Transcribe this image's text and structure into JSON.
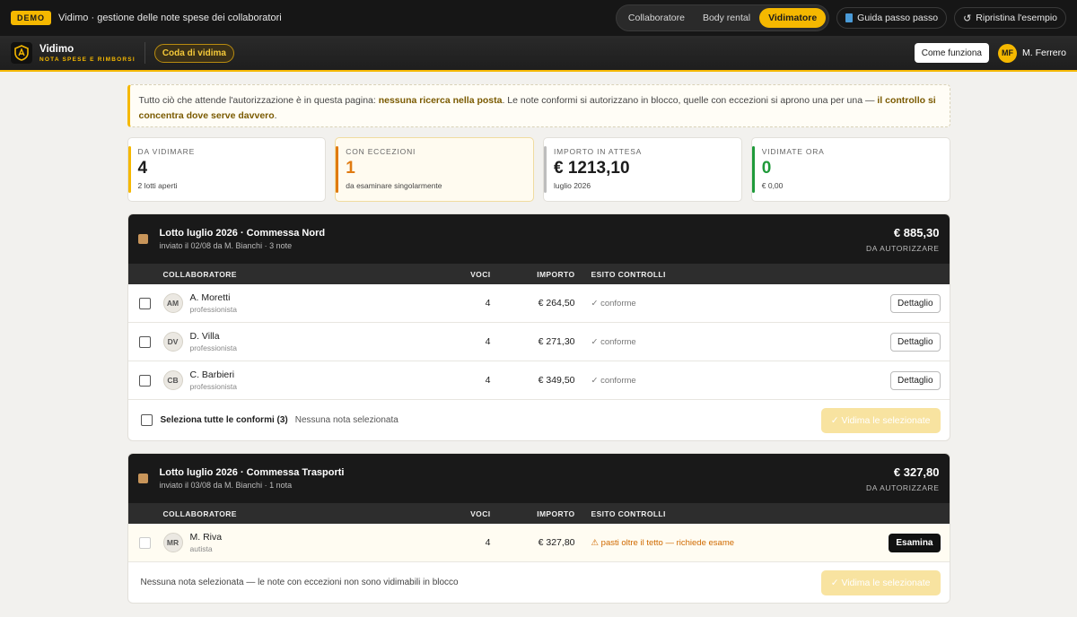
{
  "topbar": {
    "demo_badge": "DEMO",
    "title": "Vidimo · gestione delle note spese dei collaboratori",
    "roles": [
      "Collaboratore",
      "Body rental",
      "Vidimatore"
    ],
    "active_role": "Vidimatore",
    "guide_label": "Guida passo passo",
    "reset_label": "Ripristina l'esempio"
  },
  "appbar": {
    "brand_name": "Vidimo",
    "brand_sub": "NOTA SPESE E RIMBORSI",
    "queue_label": "Coda di vidima",
    "how_label": "Come funziona",
    "user_initials": "MF",
    "user_name": "M. Ferrero"
  },
  "notice": {
    "part1": "Tutto ciò che attende l'autorizzazione è in questa pagina: ",
    "bold1": "nessuna ricerca nella posta",
    "part2": ". Le note conformi si autorizzano in blocco, quelle con eccezioni si aprono una per una — ",
    "bold2": "il controllo si concentra dove serve davvero",
    "part3": "."
  },
  "kpis": [
    {
      "label": "DA VIDIMARE",
      "value": "4",
      "sub": "2 lotti aperti",
      "color": "#f5b800"
    },
    {
      "label": "CON ECCEZIONI",
      "value": "1",
      "sub": "da esaminare singolarmente",
      "color": "#e07a10"
    },
    {
      "label": "IMPORTO IN ATTESA",
      "value": "€ 1213,10",
      "sub": "luglio 2026",
      "color": "#bdbdbd"
    },
    {
      "label": "VIDIMATE ORA",
      "value": "0",
      "sub": "€ 0,00",
      "color": "#1f9a3a"
    }
  ],
  "table_headers": {
    "collaboratore": "COLLABORATORE",
    "voci": "VOCI",
    "importo": "IMPORTO",
    "esito": "ESITO CONTROLLI"
  },
  "batches": [
    {
      "title": "Lotto luglio 2026 · Commessa Nord",
      "meta": "inviato il 02/08 da M. Bianchi · 3 note",
      "amount": "€ 885,30",
      "caption": "DA AUTORIZZARE",
      "rows": [
        {
          "initials": "AM",
          "name": "A. Moretti",
          "role": "professionista",
          "voci": "4",
          "importo": "€ 264,50",
          "esito": "✓ conforme",
          "action": "Dettaglio"
        },
        {
          "initials": "DV",
          "name": "D. Villa",
          "role": "professionista",
          "voci": "4",
          "importo": "€ 271,30",
          "esito": "✓ conforme",
          "action": "Dettaglio"
        },
        {
          "initials": "CB",
          "name": "C. Barbieri",
          "role": "professionista",
          "voci": "4",
          "importo": "€ 349,50",
          "esito": "✓ conforme",
          "action": "Dettaglio"
        }
      ],
      "select_all": "Seleziona tutte le conformi (3)",
      "selection_status": "Nessuna nota selezionata",
      "vidima_label": "✓ Vidima le selezionate"
    },
    {
      "title": "Lotto luglio 2026 · Commessa Trasporti",
      "meta": "inviato il 03/08 da M. Bianchi · 1 nota",
      "amount": "€ 327,80",
      "caption": "DA AUTORIZZARE",
      "rows": [
        {
          "initials": "MR",
          "name": "M. Riva",
          "role": "autista",
          "voci": "4",
          "importo": "€ 327,80",
          "esito": "⚠ pasti oltre il tetto — richiede esame",
          "action": "Esamina"
        }
      ],
      "foot_note": "Nessuna nota selezionata — le note con eccezioni non sono vidimabili in blocco",
      "vidima_label": "✓ Vidima le selezionate"
    }
  ]
}
